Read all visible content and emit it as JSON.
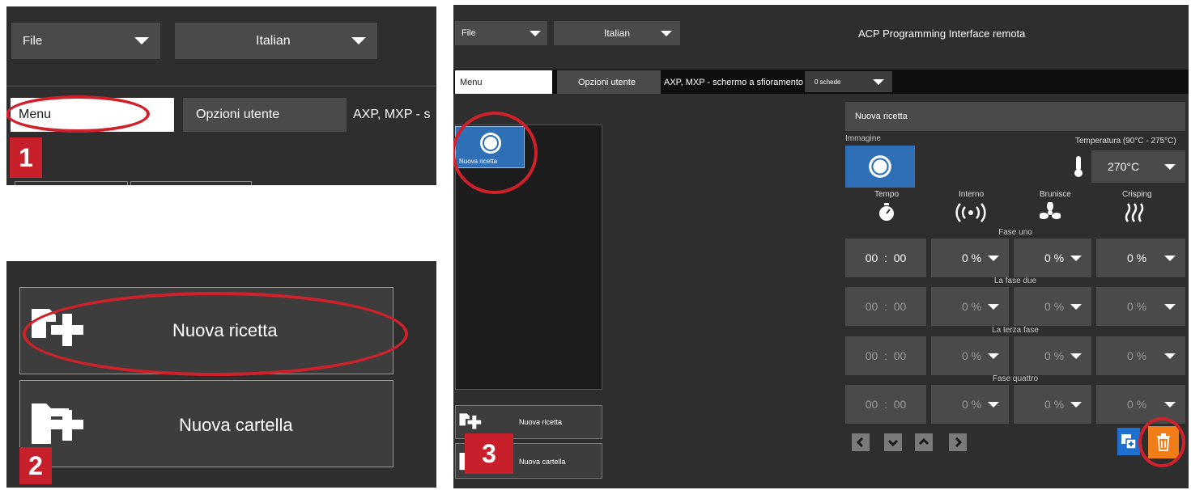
{
  "panel1": {
    "file_dropdown": "File",
    "language_dropdown": "Italian",
    "tab_menu": "Menu",
    "tab_user_options": "Opzioni utente",
    "device_label_truncated": "AXP, MXP - s",
    "badge": "1"
  },
  "panel2": {
    "new_recipe_button": "Nuova ricetta",
    "new_folder_button": "Nuova cartella",
    "badge": "2"
  },
  "panel3": {
    "file_dropdown": "File",
    "language_dropdown": "Italian",
    "app_title": "ACP Programming Interface remota",
    "tab_menu": "Menu",
    "tab_user_options": "Opzioni utente",
    "device_label": "AXP, MXP - schermo a sfioramento",
    "cards_dropdown": "0 schede",
    "recipe_tile_label": "Nuova ricetta",
    "new_recipe_button": "Nuova ricetta",
    "new_folder_button": "Nuova cartella",
    "badge": "3",
    "recipe_name": "Nuova ricetta",
    "image_label": "Immagine",
    "temperature_label": "Temperatura (90°C - 275°C)",
    "temperature_value": "270°C",
    "col_time": "Tempo",
    "col_internal": "Interno",
    "col_browning": "Brunisce",
    "col_crisping": "Crisping",
    "phases": [
      {
        "label": "Fase uno",
        "time": "00  :  00",
        "internal": "0 %",
        "browning": "0 %",
        "crisping": "0 %"
      },
      {
        "label": "La fase due",
        "time": "00  :  00",
        "internal": "0 %",
        "browning": "0 %",
        "crisping": "0 %"
      },
      {
        "label": "La terza fase",
        "time": "00  :  00",
        "internal": "0 %",
        "browning": "0 %",
        "crisping": "0 %"
      },
      {
        "label": "Fase quattro",
        "time": "00  :  00",
        "internal": "0 %",
        "browning": "0 %",
        "crisping": "0 %"
      }
    ],
    "icons": [
      "chevron-left-icon",
      "chevron-down-icon",
      "chevron-up-icon",
      "chevron-right-icon",
      "copy-plus-icon",
      "trash-icon",
      "thermometer-icon",
      "timer-icon",
      "probe-signal-icon",
      "fan-icon",
      "heat-waves-icon"
    ],
    "colors": {
      "accent_blue": "#2f6fb5",
      "delete_orange": "#f07d17",
      "highlight_red": "#d0212b",
      "badge_red": "#c8202a"
    }
  }
}
